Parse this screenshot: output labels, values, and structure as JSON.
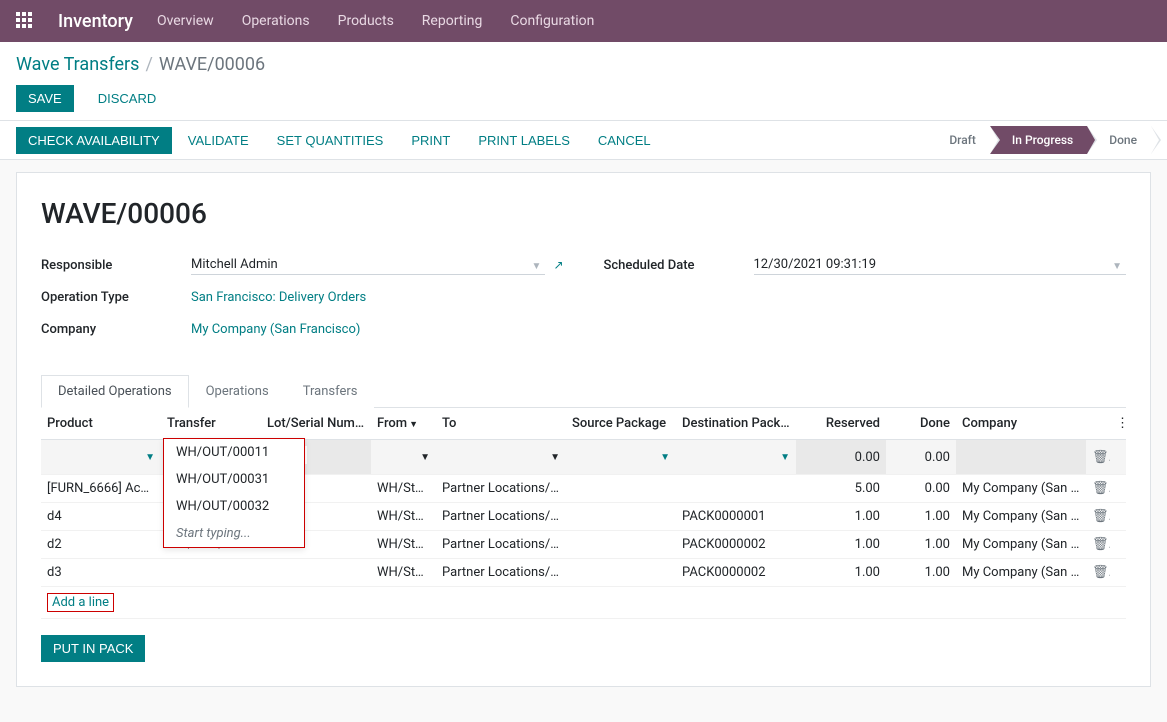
{
  "nav": {
    "app": "Inventory",
    "items": [
      "Overview",
      "Operations",
      "Products",
      "Reporting",
      "Configuration"
    ]
  },
  "breadcrumb": {
    "root": "Wave Transfers",
    "current": "WAVE/00006"
  },
  "buttons": {
    "save": "Save",
    "discard": "Discard",
    "check": "Check Availability",
    "validate": "Validate",
    "setq": "Set Quantities",
    "print": "Print",
    "labels": "Print Labels",
    "cancel": "Cancel",
    "putpack": "Put In Pack",
    "addline": "Add a line"
  },
  "status": {
    "draft": "Draft",
    "progress": "In Progress",
    "done": "Done"
  },
  "record": {
    "title": "WAVE/00006",
    "responsible_label": "Responsible",
    "responsible": "Mitchell Admin",
    "optype_label": "Operation Type",
    "optype": "San Francisco: Delivery Orders",
    "company_label": "Company",
    "company": "My Company (San Francisco)",
    "sched_label": "Scheduled Date",
    "sched": "12/30/2021 09:31:19"
  },
  "tabs": {
    "detailed": "Detailed Operations",
    "ops": "Operations",
    "transfers": "Transfers"
  },
  "columns": {
    "product": "Product",
    "transfer": "Transfer",
    "lot": "Lot/Serial Numb…",
    "from": "From",
    "to": "To",
    "srcpkg": "Source Package",
    "dstpkg": "Destination Pack…",
    "reserved": "Reserved",
    "done": "Done",
    "company": "Company"
  },
  "rows": [
    {
      "product": "",
      "transfer": "",
      "lot": "",
      "from": "",
      "to": "",
      "srcpkg": "",
      "dstpkg": "",
      "reserved": "0.00",
      "done": "0.00",
      "company": "",
      "editing": true
    },
    {
      "product": "[FURN_6666] Ac…",
      "transfer": "WH/OUT/00011",
      "lot": "",
      "from": "WH/Stock",
      "to": "Partner Locations/…",
      "srcpkg": "",
      "dstpkg": "",
      "reserved": "5.00",
      "done": "0.00",
      "company": "My Company (San …"
    },
    {
      "product": "d4",
      "transfer": "WH/OUT/00031",
      "lot": "",
      "from": "WH/Stock",
      "to": "Partner Locations/…",
      "srcpkg": "",
      "dstpkg": "PACK0000001",
      "reserved": "1.00",
      "done": "1.00",
      "company": "My Company (San …"
    },
    {
      "product": "d2",
      "transfer": "WH/OUT/00032",
      "lot": "",
      "from": "WH/Stock",
      "to": "Partner Locations/…",
      "srcpkg": "",
      "dstpkg": "PACK0000002",
      "reserved": "1.00",
      "done": "1.00",
      "company": "My Company (San …"
    },
    {
      "product": "d3",
      "transfer": "",
      "lot": "",
      "from": "WH/Stock",
      "to": "Partner Locations/…",
      "srcpkg": "",
      "dstpkg": "PACK0000002",
      "reserved": "1.00",
      "done": "1.00",
      "company": "My Company (San …"
    }
  ],
  "dropdown": {
    "items": [
      "WH/OUT/00011",
      "WH/OUT/00031",
      "WH/OUT/00032"
    ],
    "footer": "Start typing..."
  }
}
